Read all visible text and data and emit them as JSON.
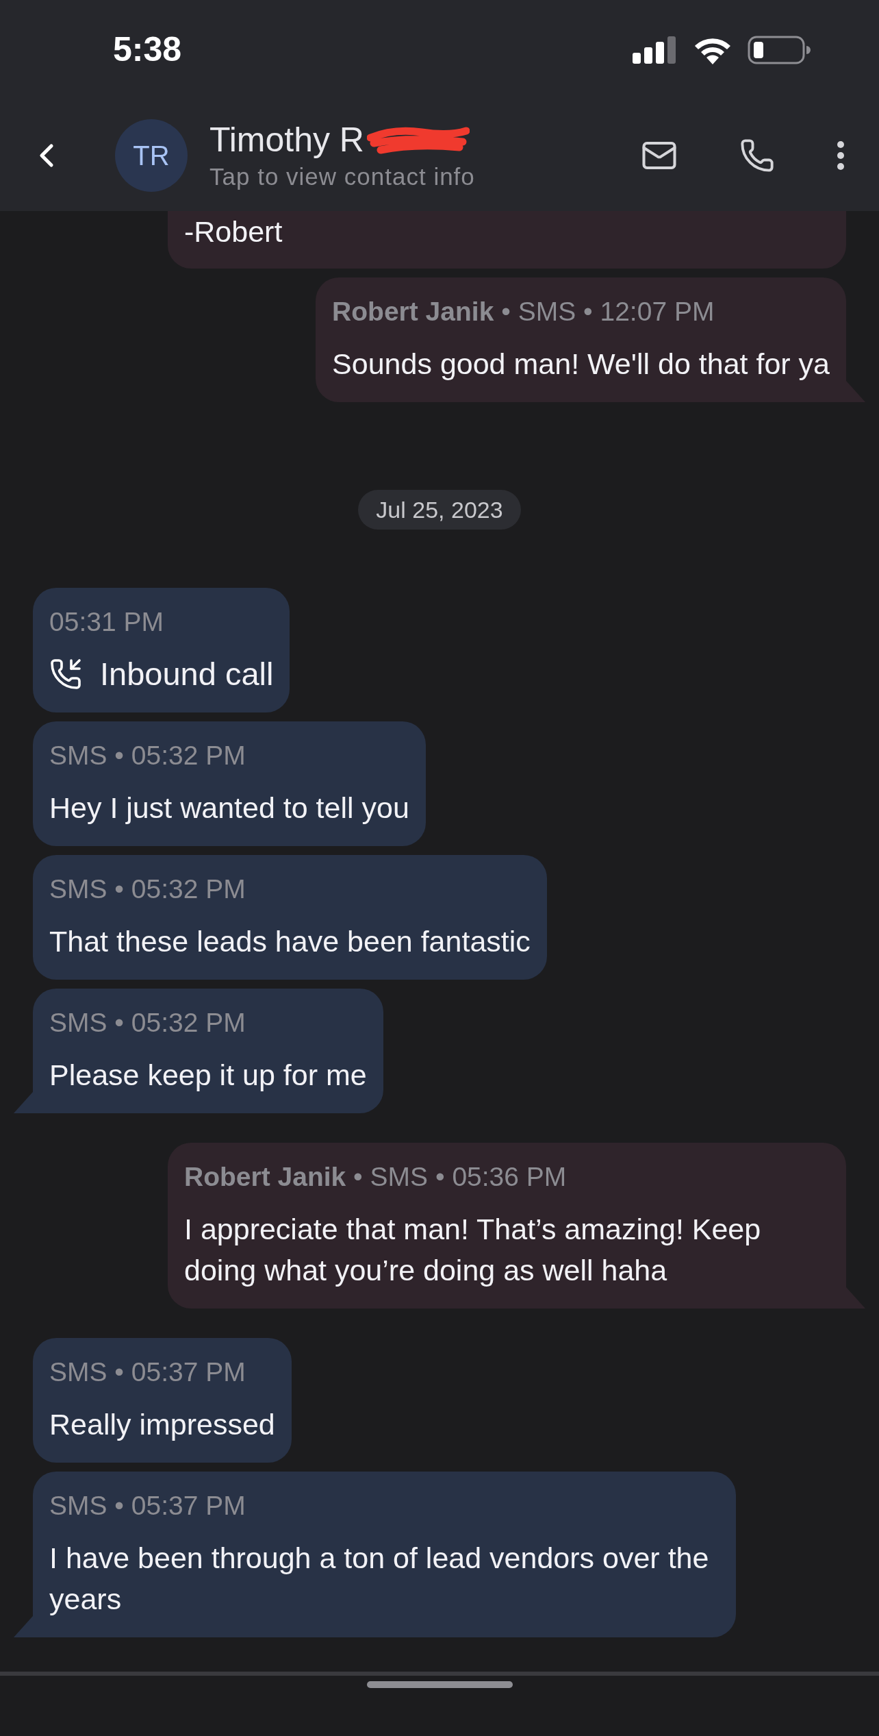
{
  "status_bar": {
    "time": "5:38"
  },
  "header": {
    "avatar_initials": "TR",
    "contact_name": "Timothy R",
    "subtitle": "Tap to view contact info",
    "redacted": true
  },
  "messages": [
    {
      "kind": "outgoing",
      "text": "-Robert",
      "tail": false
    },
    {
      "kind": "outgoing",
      "meta": "**Robert Janik** • SMS • 12:07 PM",
      "text": "Sounds good man! We'll do that for ya",
      "tail": true
    },
    {
      "kind": "date",
      "text": "Jul 25, 2023"
    },
    {
      "kind": "call",
      "meta": "05:31 PM",
      "text": "Inbound call",
      "tail": false
    },
    {
      "kind": "incoming",
      "meta": "SMS • 05:32 PM",
      "text": "Hey I just wanted to tell you",
      "tail": false
    },
    {
      "kind": "incoming",
      "meta": "SMS • 05:32 PM",
      "text": "That these leads have been fantastic",
      "tail": false
    },
    {
      "kind": "incoming",
      "meta": "SMS • 05:32 PM",
      "text": "Please keep it up for me",
      "tail": true
    },
    {
      "kind": "outgoing",
      "meta": "**Robert Janik** • SMS • 05:36 PM",
      "text": "I appreciate that man! That’s amazing! Keep doing what you’re doing as well haha",
      "tail": true
    },
    {
      "kind": "incoming",
      "meta": "SMS • 05:37 PM",
      "text": "Really impressed",
      "tail": false
    },
    {
      "kind": "incoming",
      "meta": "SMS • 05:37 PM",
      "text": "I have been through a ton of lead vendors over the years",
      "tail": true
    }
  ]
}
